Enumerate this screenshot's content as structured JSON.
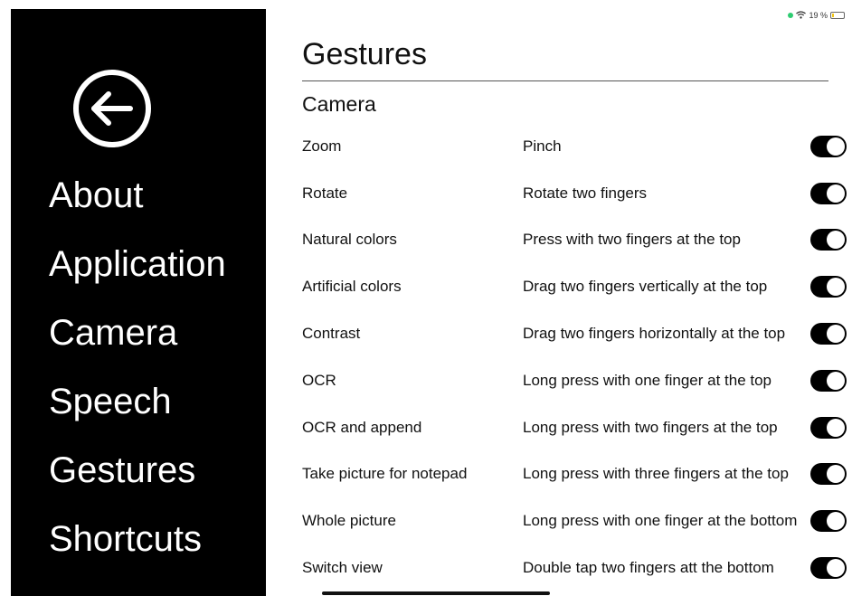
{
  "status_bar": {
    "battery_text": "19 %",
    "battery_level": 0.19,
    "icons": [
      "green-dot-icon",
      "wifi-icon",
      "battery-charging-icon"
    ]
  },
  "sidebar": {
    "back_icon": "back-arrow-circle-icon",
    "items": [
      {
        "label": "About"
      },
      {
        "label": "Application"
      },
      {
        "label": "Camera"
      },
      {
        "label": "Speech"
      },
      {
        "label": "Gestures"
      },
      {
        "label": "Shortcuts"
      }
    ]
  },
  "main": {
    "title": "Gestures",
    "section": "Camera",
    "rows": [
      {
        "label": "Zoom",
        "gesture": "Pinch",
        "enabled": true
      },
      {
        "label": "Rotate",
        "gesture": "Rotate two fingers",
        "enabled": true
      },
      {
        "label": "Natural colors",
        "gesture": "Press with two fingers at the top",
        "enabled": true
      },
      {
        "label": "Artificial colors",
        "gesture": "Drag two fingers vertically at the top",
        "enabled": true
      },
      {
        "label": "Contrast",
        "gesture": "Drag two fingers horizontally at the top",
        "enabled": true
      },
      {
        "label": "OCR",
        "gesture": "Long press with one finger at the top",
        "enabled": true
      },
      {
        "label": "OCR and append",
        "gesture": "Long press with two fingers at the top",
        "enabled": true
      },
      {
        "label": "Take picture for notepad",
        "gesture": "Long press with three fingers at the top",
        "enabled": true
      },
      {
        "label": "Whole picture",
        "gesture": "Long press with one finger at the bottom",
        "enabled": true
      },
      {
        "label": "Switch view",
        "gesture": "Double tap two fingers att the bottom",
        "enabled": true
      }
    ]
  },
  "colors": {
    "sidebar_bg": "#000000",
    "toggle_on": "#000000",
    "text": "#111111"
  }
}
